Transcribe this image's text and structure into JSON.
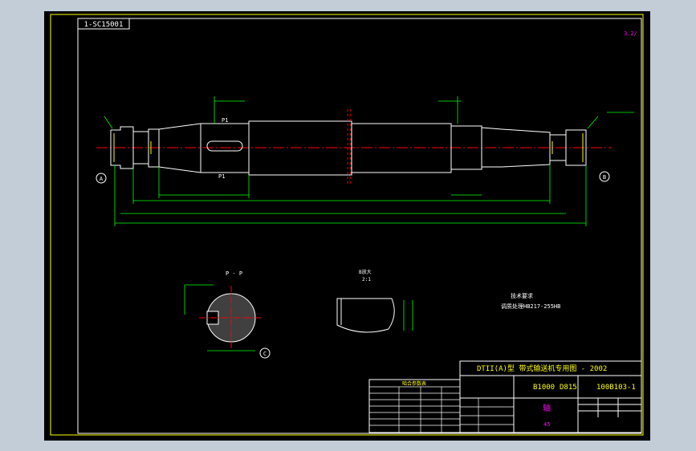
{
  "drawing": {
    "code_box": "1-SC15001",
    "scale_mark": "3.2/",
    "tech_title": "技术要求",
    "tech_note": "调质处理HB217-255HB",
    "section_label": "P - P",
    "detail_label": "B放大",
    "detail_scale": "2:1",
    "shaft_labels": {
      "p1_top": "P1",
      "p1_bottom": "P1",
      "datum_a": "A",
      "datum_b": "B",
      "datum_c": "C"
    }
  },
  "title_block": {
    "title": "DTII(A)型  带式输送机专用图 - 2002",
    "spec_1": "B1000",
    "spec_2": "D815",
    "drawing_no": "100B103-1",
    "part_name": "轴",
    "material": "45"
  },
  "param_table": {
    "header": "啮合参数表",
    "rows": [
      "",
      "",
      "",
      "",
      "",
      "",
      ""
    ]
  },
  "colors": {
    "background": "#c2cdd8",
    "sheet": "#000000",
    "frame": "#ffff00",
    "geometry": "#ffffff",
    "dimension": "#00ff00",
    "centerline": "#ff0000",
    "annotation": "#ff00ff"
  }
}
